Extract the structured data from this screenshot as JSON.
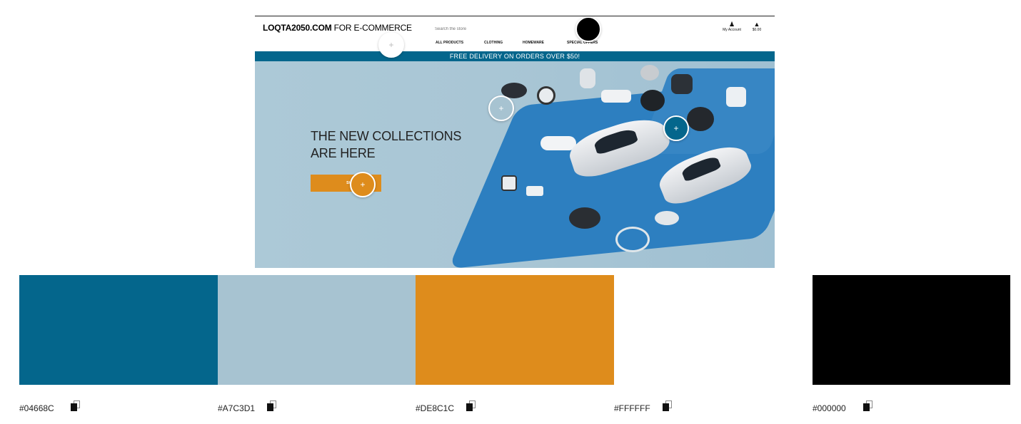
{
  "site": {
    "logo_bold": "LOQTA2050.COM",
    "logo_rest": " FOR E-COMMERCE",
    "search_placeholder": "Search the store",
    "nav": [
      "ALL PRODUCTS",
      "CLOTHING",
      "HOMEWARE",
      "SPECIAL OFFERS"
    ],
    "account_label": "My Account",
    "cart_label": "$0.00",
    "banner": "FREE DELIVERY ON ORDERS OVER $50!",
    "headline_line1": "THE NEW COLLECTIONS",
    "headline_line2": "ARE HERE",
    "cta_label": "SHOP NOW",
    "hotspot_symbol": "+"
  },
  "palette": [
    {
      "hex": "#04668C"
    },
    {
      "hex": "#A7C3D1"
    },
    {
      "hex": "#DE8C1C"
    },
    {
      "hex": "#FFFFFF"
    },
    {
      "hex": "#000000"
    }
  ],
  "icons": {
    "account": "person-icon",
    "cart": "bag-icon",
    "copy": "copy-icon",
    "hotspot": "plus-icon"
  }
}
